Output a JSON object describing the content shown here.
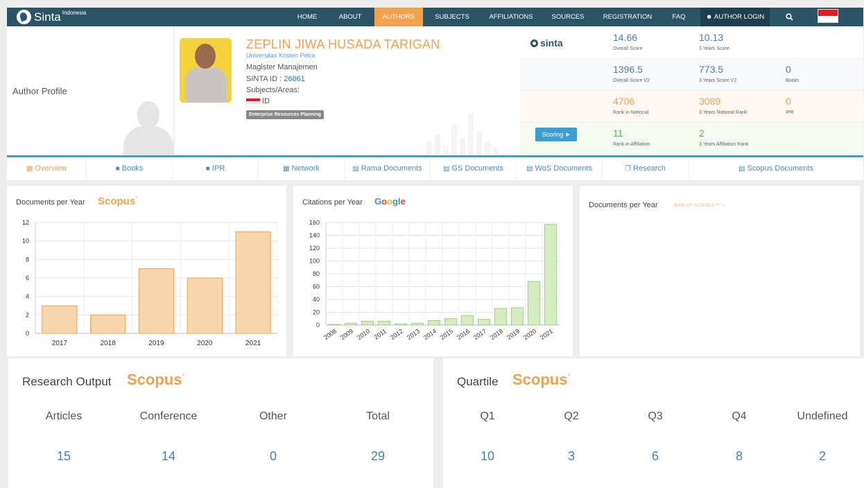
{
  "nav": {
    "brand": "Sinta",
    "brand_sup": "Indonesia",
    "items": [
      {
        "label": "HOME"
      },
      {
        "label": "ABOUT"
      },
      {
        "label": "AUTHORS"
      },
      {
        "label": "SUBJECTS"
      },
      {
        "label": "AFFILIATIONS"
      },
      {
        "label": "SOURCES"
      },
      {
        "label": "REGISTRATION"
      },
      {
        "label": "FAQ"
      },
      {
        "label": "AUTHOR LOGIN"
      }
    ],
    "active": "AUTHORS"
  },
  "profile": {
    "section_label": "Author Profile",
    "name": "ZEPLIN JIWA HUSADA TARIGAN",
    "university": "Universitas Kristen Petra",
    "program": "Magister Manajemen",
    "sinta_id_label": "SINTA ID : ",
    "sinta_id": "26861",
    "subjects_label": "Subjects/Areas:",
    "country": "ID",
    "subject_tag": "Enterprise Resources Planning"
  },
  "scores": {
    "logo": "sinta",
    "overall_score": {
      "value": "14.66",
      "label": "Overall Score"
    },
    "three_year_score": {
      "value": "10.13",
      "label": "3 Years Score"
    },
    "overall_score_v2": {
      "value": "1396.5",
      "label": "Overall Score V2"
    },
    "three_year_score_v2": {
      "value": "773.5",
      "label": "3 Years Score V2"
    },
    "books": {
      "value": "0",
      "label": "Books"
    },
    "rank_national": {
      "value": "4706",
      "label": "Rank in National"
    },
    "three_year_national": {
      "value": "3089",
      "label": "3 Years National Rank"
    },
    "ipr": {
      "value": "0",
      "label": "IPR"
    },
    "scoring_button": "Scoring",
    "rank_affiliation": {
      "value": "11",
      "label": "Rank in Affiliation"
    },
    "three_year_affiliation": {
      "value": "2",
      "label": "3 Years Affiliation Rank"
    }
  },
  "tabs": [
    {
      "label": "Overview",
      "icon": "bar-chart-icon"
    },
    {
      "label": "Books",
      "icon": "book-icon"
    },
    {
      "label": "IPR",
      "icon": "book-icon"
    },
    {
      "label": "Network",
      "icon": "sitemap-icon"
    },
    {
      "label": "Rama Documents",
      "icon": "document-icon"
    },
    {
      "label": "GS Documents",
      "icon": "document-icon"
    },
    {
      "label": "WoS Documents",
      "icon": "document-icon"
    },
    {
      "label": "Research",
      "icon": "copy-icon"
    },
    {
      "label": "Scopus Documents",
      "icon": "document-icon"
    }
  ],
  "cards": {
    "scopus_docs_title": "Documents per Year",
    "scopus_brand": "Scopus",
    "citations_title": "Citations per Year",
    "google_brand": "Google",
    "wos_title": "Documents per Year",
    "wos_brand": "WEB OF SCIENCE"
  },
  "chart_data": [
    {
      "type": "bar",
      "title": "Documents per Year",
      "categories": [
        "2017",
        "2018",
        "2019",
        "2020",
        "2021"
      ],
      "values": [
        3,
        2,
        7,
        6,
        11
      ],
      "ylim": [
        0,
        12
      ],
      "yticks": [
        0,
        2,
        4,
        6,
        8,
        10,
        12
      ],
      "grid": true,
      "color": "#f9d5ae",
      "stroke": "#f5a04d"
    },
    {
      "type": "bar",
      "title": "Citations per Year",
      "categories": [
        "2008",
        "2009",
        "2010",
        "2011",
        "2012",
        "2013",
        "2014",
        "2015",
        "2016",
        "2017",
        "2018",
        "2019",
        "2020",
        "2021"
      ],
      "values": [
        1,
        3,
        6,
        6,
        2,
        3,
        7,
        10,
        15,
        9,
        26,
        27,
        68,
        157
      ],
      "ylim": [
        0,
        160
      ],
      "yticks": [
        0,
        20,
        40,
        60,
        80,
        100,
        120,
        140,
        160
      ],
      "grid": true,
      "color": "#d4ecbf",
      "stroke": "#9fd07a"
    }
  ],
  "research_output": {
    "title": "Research Output",
    "brand": "Scopus",
    "columns": [
      {
        "label": "Articles",
        "value": "15"
      },
      {
        "label": "Conference",
        "value": "14"
      },
      {
        "label": "Other",
        "value": "0"
      },
      {
        "label": "Total",
        "value": "29"
      }
    ]
  },
  "quartile": {
    "title": "Quartile",
    "brand": "Scopus",
    "columns": [
      {
        "label": "Q1",
        "value": "10"
      },
      {
        "label": "Q2",
        "value": "3"
      },
      {
        "label": "Q3",
        "value": "6"
      },
      {
        "label": "Q4",
        "value": "8"
      },
      {
        "label": "Undefined",
        "value": "2"
      }
    ]
  },
  "colors": {
    "navbar": "#2b5467",
    "accent_orange": "#f5a04d",
    "accent_blue": "#3f9fc3",
    "value_blue": "#4a7fb0",
    "green": "#63b54a"
  }
}
